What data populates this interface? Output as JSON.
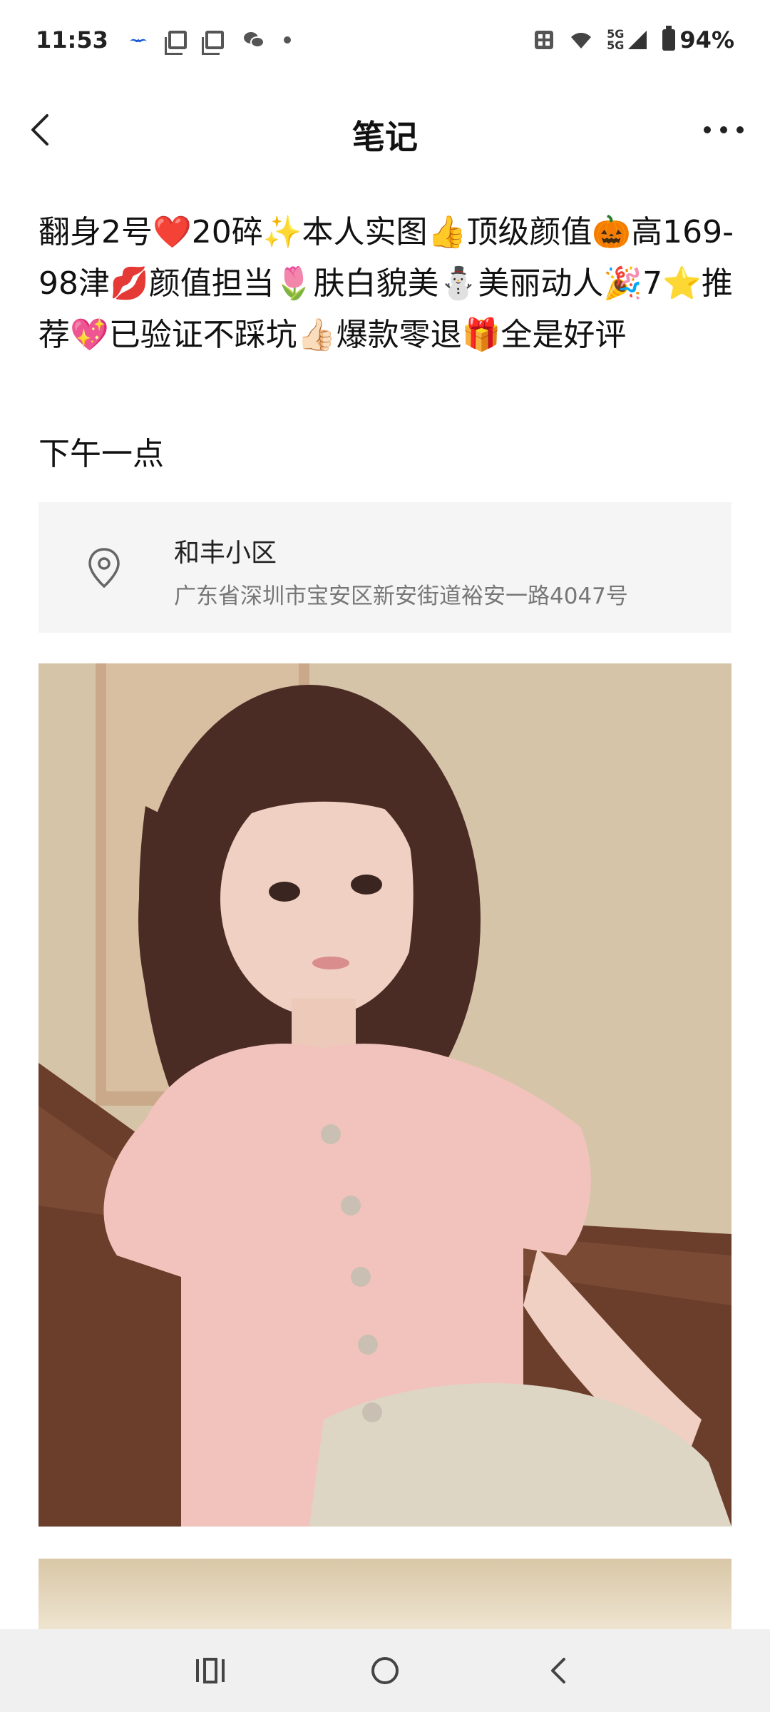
{
  "status_bar": {
    "time": "11:53",
    "battery": "94%",
    "network": "5G",
    "network2": "5G"
  },
  "nav": {
    "title": "笔记"
  },
  "note": {
    "text": "翻身2号❤️20碎✨本人实图👍顶级颜值🎃高169-98津💋颜值担当🌷肤白貌美⛄美丽动人🎉7⭐推荐💖已验证不踩坑👍🏻爆款零退🎁全是好评",
    "time": "下午一点"
  },
  "location": {
    "name": "和丰小区",
    "address": "广东省深圳市宝安区新安街道裕安一路4047号"
  },
  "icons": {
    "back": "back-arrow-icon",
    "more": "more-icon",
    "location": "location-pin-icon",
    "recents": "recents-icon",
    "home": "home-icon",
    "nav_back": "nav-back-icon"
  },
  "colors": {
    "card_bg": "#f5f5f5",
    "address_text": "#777777",
    "nav_bg": "#f0f0f0"
  }
}
